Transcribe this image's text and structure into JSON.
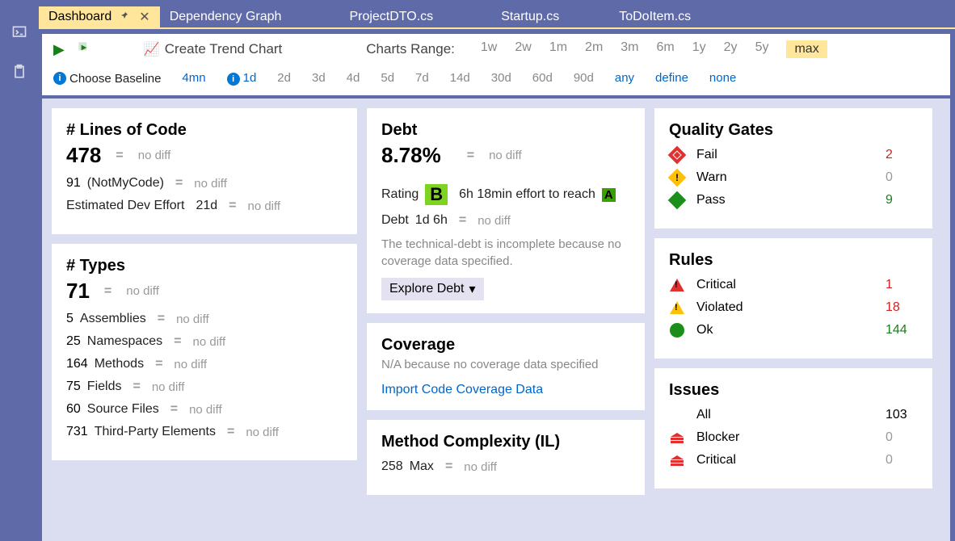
{
  "tabs": [
    {
      "label": "Dashboard",
      "active": true,
      "pinned": true
    },
    {
      "label": "Dependency Graph"
    },
    {
      "label": "ProjectDTO.cs"
    },
    {
      "label": "Startup.cs"
    },
    {
      "label": "ToDoItem.cs"
    }
  ],
  "toolbar": {
    "trend_label": "Create Trend Chart",
    "range_label": "Charts Range:",
    "ranges": [
      "1w",
      "2w",
      "1m",
      "2m",
      "3m",
      "6m",
      "1y",
      "2y",
      "5y",
      "max"
    ],
    "range_selected": "max",
    "baseline_label": "Choose Baseline",
    "baselines": [
      "4mn",
      "1d",
      "2d",
      "3d",
      "4d",
      "5d",
      "7d",
      "14d",
      "30d",
      "60d",
      "90d",
      "any",
      "define",
      "none"
    ],
    "baseline_selected": "1d"
  },
  "loc": {
    "title": "# Lines of Code",
    "value": "478",
    "diff": "no diff",
    "notmycode_count": "91",
    "notmycode_label": "(NotMyCode)",
    "notmycode_diff": "no diff",
    "effort_label": "Estimated Dev Effort",
    "effort_value": "21d",
    "effort_diff": "no diff"
  },
  "types": {
    "title": "# Types",
    "value": "71",
    "diff": "no diff",
    "rows": [
      {
        "count": "5",
        "label": "Assemblies",
        "diff": "no diff"
      },
      {
        "count": "25",
        "label": "Namespaces",
        "diff": "no diff"
      },
      {
        "count": "164",
        "label": "Methods",
        "diff": "no diff"
      },
      {
        "count": "75",
        "label": "Fields",
        "diff": "no diff"
      },
      {
        "count": "60",
        "label": "Source Files",
        "diff": "no diff"
      },
      {
        "count": "731",
        "label": "Third-Party Elements",
        "diff": "no diff"
      }
    ]
  },
  "debt": {
    "title": "Debt",
    "value": "8.78%",
    "diff": "no diff",
    "rating_label": "Rating",
    "rating": "B",
    "effort": "6h  18min effort to reach",
    "target": "A",
    "debt_label": "Debt",
    "debt_value": "1d  6h",
    "debt_diff": "no diff",
    "note": "The technical-debt is incomplete because no coverage data specified.",
    "explore": "Explore Debt"
  },
  "coverage": {
    "title": "Coverage",
    "note": "N/A because no coverage data specified",
    "link": "Import Code Coverage Data"
  },
  "complexity": {
    "title": "Method Complexity (IL)",
    "max_val": "258",
    "max_label": "Max",
    "max_diff": "no diff"
  },
  "quality_gates": {
    "title": "Quality Gates",
    "rows": [
      {
        "icon": "fail",
        "label": "Fail",
        "count": "2",
        "cls": "red"
      },
      {
        "icon": "warn",
        "label": "Warn",
        "count": "0",
        "cls": "gray"
      },
      {
        "icon": "pass",
        "label": "Pass",
        "count": "9",
        "cls": "green"
      }
    ]
  },
  "rules": {
    "title": "Rules",
    "rows": [
      {
        "icon": "critical",
        "label": "Critical",
        "count": "1",
        "cls": "red"
      },
      {
        "icon": "violated",
        "label": "Violated",
        "count": "18",
        "cls": "red"
      },
      {
        "icon": "ok",
        "label": "Ok",
        "count": "144",
        "cls": "green"
      }
    ]
  },
  "issues": {
    "title": "Issues",
    "rows": [
      {
        "icon": "",
        "label": "All",
        "count": "103",
        "cls": ""
      },
      {
        "icon": "blocker",
        "label": "Blocker",
        "count": "0",
        "cls": "gray"
      },
      {
        "icon": "blocker",
        "label": "Critical",
        "count": "0",
        "cls": "gray"
      }
    ]
  }
}
